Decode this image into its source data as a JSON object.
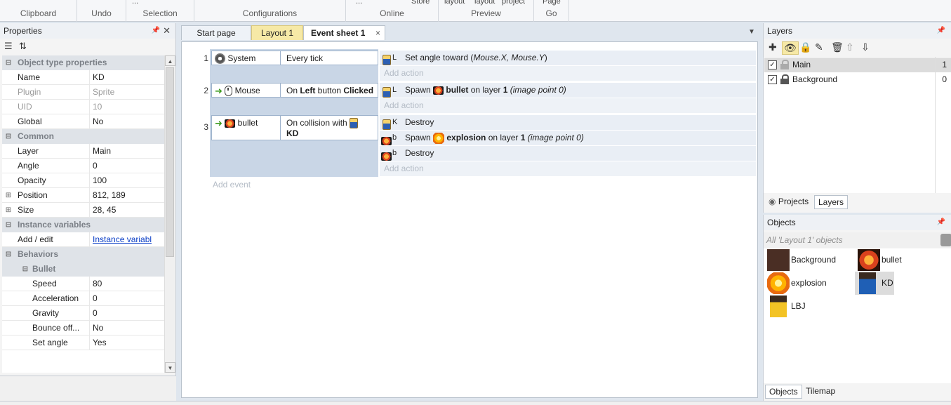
{
  "ribbon": {
    "groups": [
      "Clipboard",
      "Undo",
      "Selection",
      "Configurations",
      "Online",
      "Preview",
      "Go"
    ],
    "overflow": [
      "Store",
      "layout",
      "layout",
      "project",
      "Page",
      "...",
      "..."
    ]
  },
  "properties": {
    "title": "Properties",
    "rows": [
      {
        "type": "cat",
        "key": "Object type properties",
        "exp": "⊟"
      },
      {
        "key": "Name",
        "value": "KD"
      },
      {
        "key": "Plugin",
        "value": "Sprite",
        "gray": true
      },
      {
        "key": "UID",
        "value": "10",
        "gray": true
      },
      {
        "key": "Global",
        "value": "No"
      },
      {
        "type": "cat",
        "key": "Common",
        "exp": "⊟"
      },
      {
        "key": "Layer",
        "value": "Main"
      },
      {
        "key": "Angle",
        "value": "0"
      },
      {
        "key": "Opacity",
        "value": "100"
      },
      {
        "key": "Position",
        "value": "812, 189",
        "exp": "⊞"
      },
      {
        "key": "Size",
        "value": "28, 45",
        "exp": "⊞"
      },
      {
        "type": "cat",
        "key": "Instance variables",
        "exp": "⊟"
      },
      {
        "key": "Add / edit",
        "value": "Instance variabl",
        "link": true
      },
      {
        "type": "cat",
        "key": "Behaviors",
        "exp": "⊟"
      },
      {
        "type": "cat",
        "key": "Bullet",
        "exp": "⊟",
        "indent": true
      },
      {
        "key": "Speed",
        "value": "80",
        "indent": true
      },
      {
        "key": "Acceleration",
        "value": "0",
        "indent": true
      },
      {
        "key": "Gravity",
        "value": "0",
        "indent": true
      },
      {
        "key": "Bounce off...",
        "value": "No",
        "indent": true
      },
      {
        "key": "Set angle",
        "value": "Yes",
        "indent": true
      }
    ]
  },
  "tabs": {
    "start": "Start page",
    "layout": "Layout 1",
    "event": "Event sheet 1",
    "close": "×"
  },
  "events": [
    {
      "num": "1",
      "obj": "System",
      "cond": "Every tick",
      "actions": [
        {
          "icon": "person",
          "letter": "L",
          "pre": "Set angle toward (",
          "italic": "Mouse.X, Mouse.Y",
          "post": ")"
        }
      ],
      "add_action": "Add action"
    },
    {
      "num": "2",
      "obj": "Mouse",
      "cond_pre": "On ",
      "cond_bold": "Left",
      "cond_mid": " button ",
      "cond_bold2": "Clicked",
      "actions": [
        {
          "icon": "person",
          "letter": "L",
          "pre": "Spawn ",
          "bold": "bullet",
          "mid": " on layer ",
          "bold2": "1",
          "italic": " (image point 0)"
        }
      ],
      "add_action": "Add action"
    },
    {
      "num": "3",
      "obj": "bullet",
      "cond_pre": "On collision with",
      "cond_bold": "KD",
      "actions": [
        {
          "icon": "person",
          "letter": "K",
          "pre": "Destroy"
        },
        {
          "icon": "bullet",
          "letter": "b",
          "pre": "Spawn ",
          "bold": "explosion",
          "mid": " on layer ",
          "bold2": "1",
          "italic": " (image point 0)"
        },
        {
          "icon": "bullet",
          "letter": "b",
          "pre": "Destroy"
        }
      ],
      "add_action": "Add action"
    }
  ],
  "add_event": "Add event",
  "layers": {
    "title": "Layers",
    "items": [
      {
        "name": "Main",
        "num": "1"
      },
      {
        "name": "Background",
        "num": "0"
      }
    ],
    "tabs": [
      "Projects",
      "Layers"
    ]
  },
  "objects": {
    "title": "Objects",
    "filter": "All 'Layout 1' objects",
    "items": [
      "Background",
      "bullet",
      "explosion",
      "KD",
      "LBJ"
    ],
    "tabs": [
      "Objects",
      "Tilemap"
    ]
  },
  "colors": {
    "accent": "#f6e9a6",
    "selection": "#dcdcdc",
    "event_bg": "#c9d6e6"
  }
}
